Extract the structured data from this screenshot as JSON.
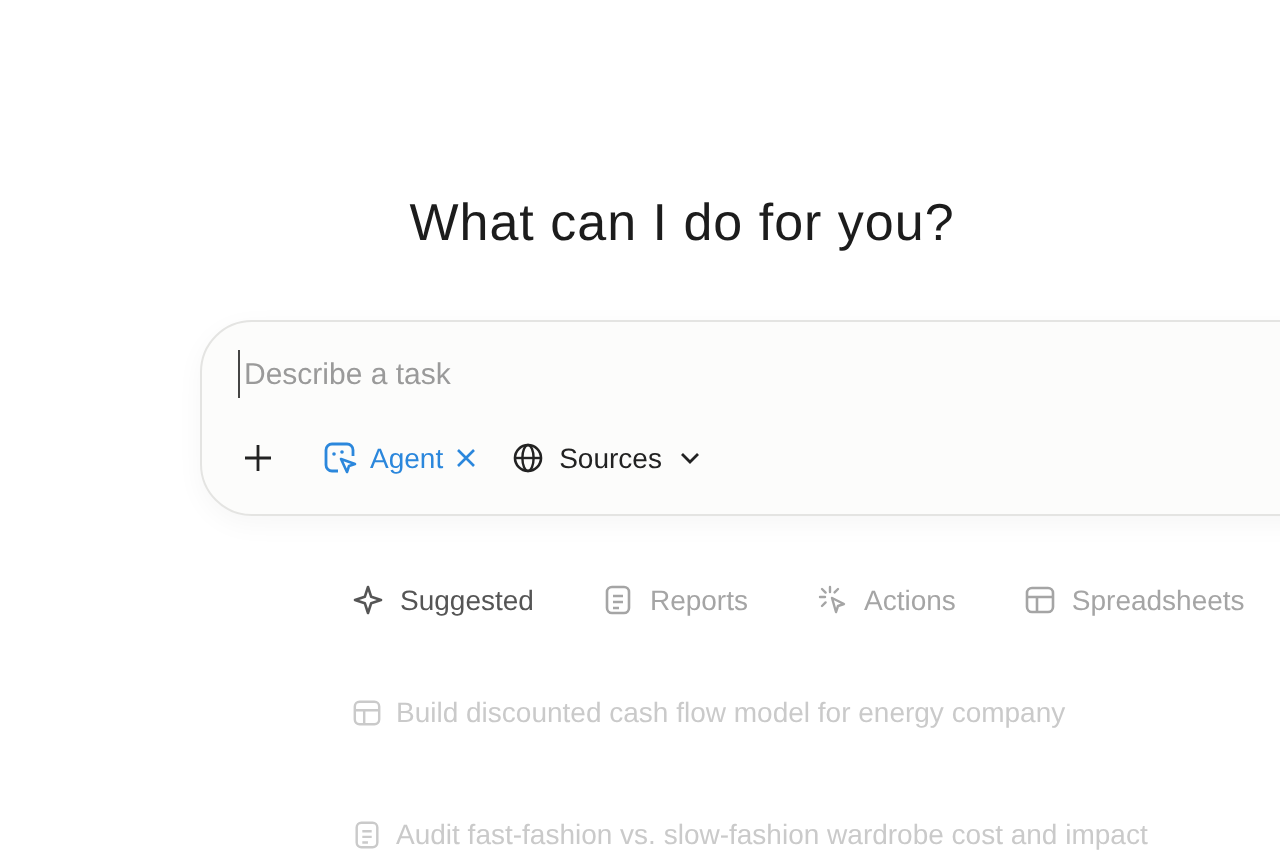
{
  "heading": "What can I do for you?",
  "composer": {
    "placeholder": "Describe a task",
    "mode": {
      "label": "Agent"
    },
    "sources": {
      "label": "Sources"
    }
  },
  "categories": [
    {
      "label": "Suggested",
      "kind": "sparkle",
      "selected": true
    },
    {
      "label": "Reports",
      "kind": "document",
      "selected": false
    },
    {
      "label": "Actions",
      "kind": "pointer",
      "selected": false
    },
    {
      "label": "Spreadsheets",
      "kind": "table",
      "selected": false
    }
  ],
  "suggestions": [
    {
      "text": "Build discounted cash flow model for energy company",
      "kind": "table"
    },
    {
      "text": "Audit fast-fashion vs. slow-fashion wardrobe cost and impact",
      "kind": "document"
    }
  ]
}
